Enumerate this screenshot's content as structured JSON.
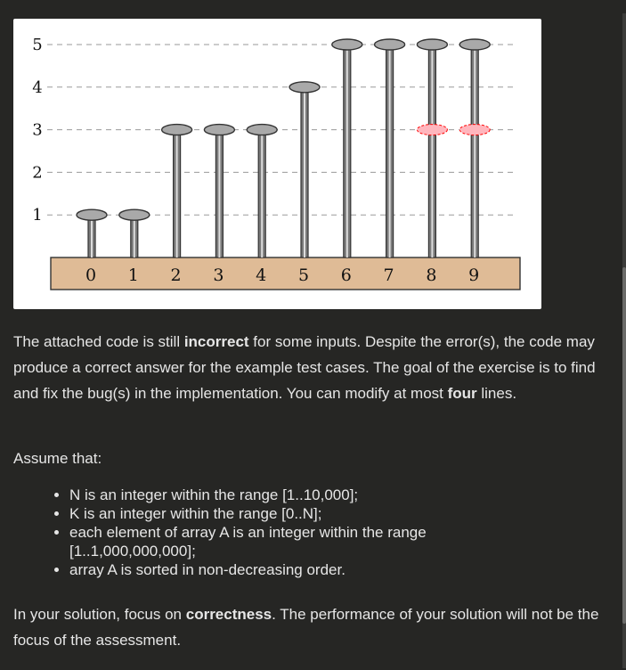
{
  "figure": {
    "y_ticks": [
      "1",
      "2",
      "3",
      "4",
      "5"
    ],
    "indices": [
      "0",
      "1",
      "2",
      "3",
      "4",
      "5",
      "6",
      "7",
      "8",
      "9"
    ],
    "pillar_heights": [
      1,
      1,
      3,
      3,
      3,
      4,
      5,
      5,
      5,
      5
    ],
    "highlighted_level": 3,
    "highlighted_indices": [
      8,
      9
    ],
    "colors": {
      "base": "#dfbb96",
      "cap": "#a9a9a9",
      "highlight": "#ffb6bd",
      "highlight_border": "#ff0000"
    }
  },
  "statement": {
    "p1_a": "The attached code is still ",
    "p1_b": "incorrect",
    "p1_c": " for some inputs. Despite the error(s), the code may produce a correct answer for the example test cases. The goal of the exercise is to find and fix the bug(s) in the implementation. You can modify at most ",
    "p1_d": "four",
    "p1_e": " lines."
  },
  "assume": {
    "intro": "Assume that:",
    "items": [
      "N is an integer within the range [1..10,000];",
      "K is an integer within the range [0..N];",
      "each element of array A is an integer within the range [1..1,000,000,000];",
      "array A is sorted in non-decreasing order."
    ]
  },
  "focus": {
    "a": "In your solution, focus on ",
    "b": "correctness",
    "c": ". The performance of your solution will not be the focus of the assessment."
  }
}
